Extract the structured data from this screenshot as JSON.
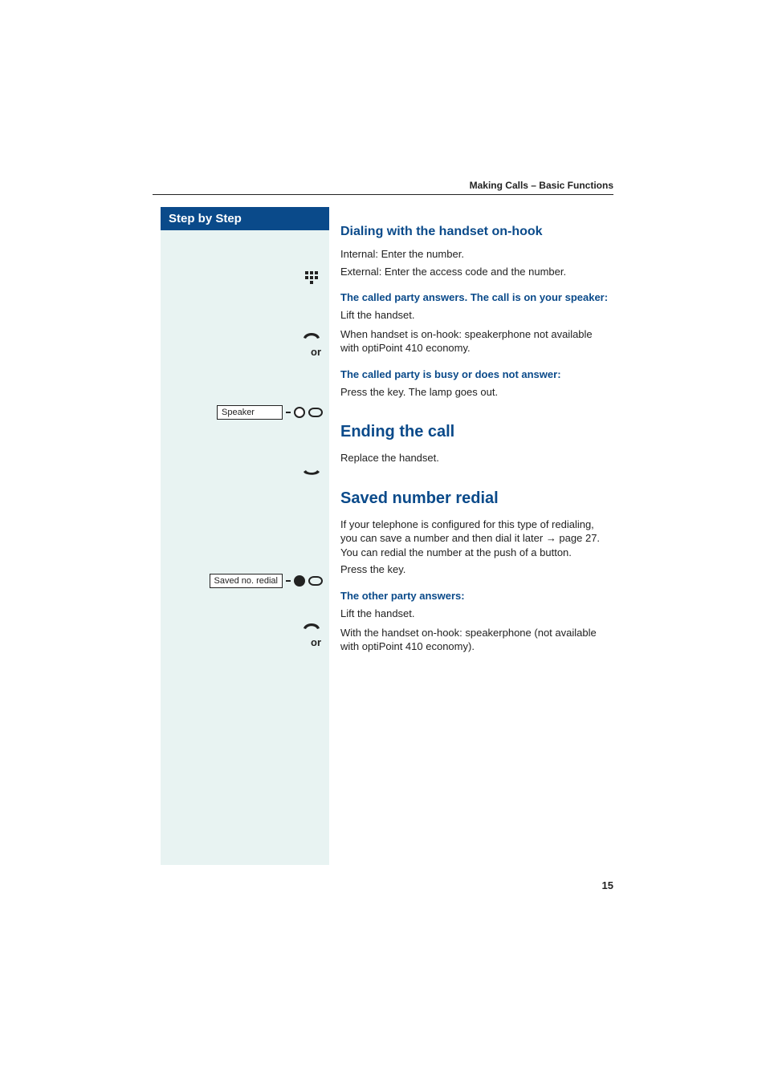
{
  "header": "Making Calls – Basic Functions",
  "sidebar": {
    "title": "Step by Step",
    "or": "or",
    "keys": {
      "speaker": "Speaker",
      "saved_redial": "Saved no. redial"
    }
  },
  "section1": {
    "title": "Dialing with the handset on-hook",
    "line1": "Internal: Enter the number.",
    "line2": "External: Enter the access code and the number.",
    "sub1": "The called party answers. The call is on your speaker:",
    "lift": "Lift the handset.",
    "alt": "When handset is on-hook: speakerphone not available with optiPoint 410 economy.",
    "sub2": "The called party is busy or does not answer:",
    "press": "Press the key. The lamp goes out."
  },
  "section2": {
    "title": "Ending the call",
    "replace": "Replace the handset."
  },
  "section3": {
    "title": "Saved number redial",
    "intro1": "If your telephone is configured for this type of redialing, you can save a number and then dial it later → page 27. You can redial the number at the push of a button.",
    "press": "Press the key.",
    "sub1": "The other party answers:",
    "lift": "Lift the handset.",
    "alt": "With the handset on-hook: speakerphone (not available with optiPoint 410 economy)."
  },
  "pageNumber": "15"
}
